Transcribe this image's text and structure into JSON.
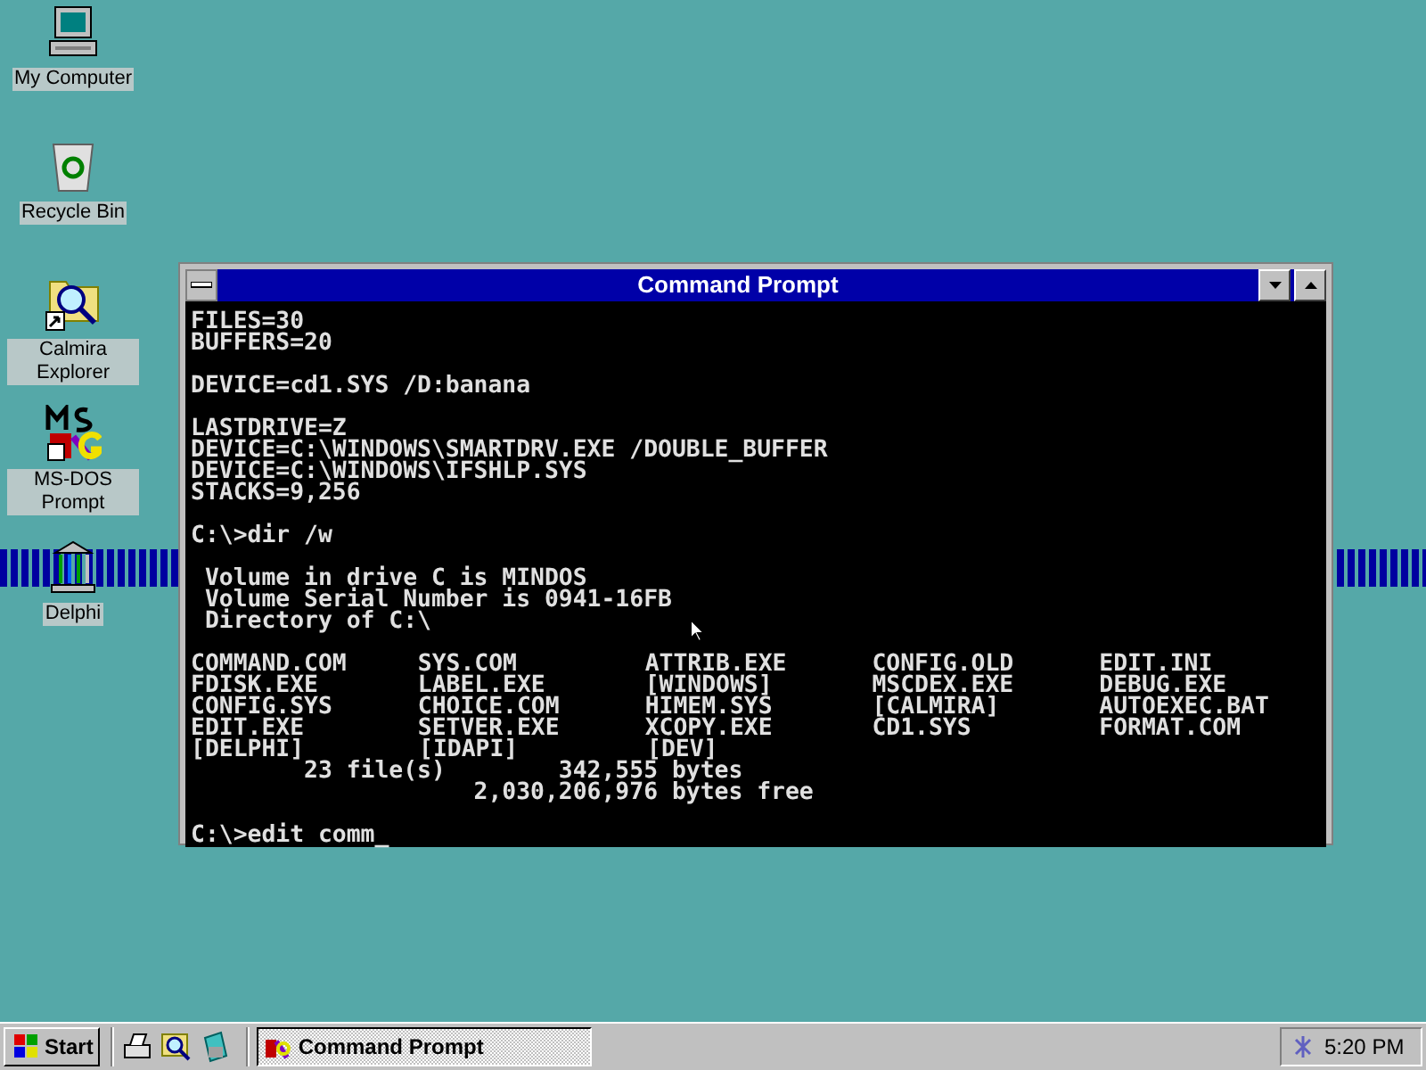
{
  "desktop_icons": [
    {
      "label": "My Computer",
      "kind": "computer"
    },
    {
      "label": "Recycle Bin",
      "kind": "bin"
    },
    {
      "label": "Calmira Explorer",
      "kind": "explorer"
    },
    {
      "label": "MS-DOS Prompt",
      "kind": "msdos"
    },
    {
      "label": "Delphi",
      "kind": "delphi"
    }
  ],
  "window": {
    "title": "Command Prompt",
    "console": [
      {
        "kind": "line",
        "text": "FILES=30"
      },
      {
        "kind": "line",
        "text": "BUFFERS=20"
      },
      {
        "kind": "blank"
      },
      {
        "kind": "line",
        "text": "DEVICE=cd1.SYS /D:banana"
      },
      {
        "kind": "blank"
      },
      {
        "kind": "line",
        "text": "LASTDRIVE=Z"
      },
      {
        "kind": "line",
        "text": "DEVICE=C:\\WINDOWS\\SMARTDRV.EXE /DOUBLE_BUFFER"
      },
      {
        "kind": "line",
        "text": "DEVICE=C:\\WINDOWS\\IFSHLP.SYS"
      },
      {
        "kind": "line",
        "text": "STACKS=9,256"
      },
      {
        "kind": "blank"
      },
      {
        "kind": "line",
        "text": "C:\\>dir /w"
      },
      {
        "kind": "blank"
      },
      {
        "kind": "line",
        "text": " Volume in drive C is MINDOS"
      },
      {
        "kind": "line",
        "text": " Volume Serial Number is 0941-16FB"
      },
      {
        "kind": "line",
        "text": " Directory of C:\\"
      },
      {
        "kind": "blank"
      },
      {
        "kind": "files",
        "rows": [
          [
            "COMMAND.COM",
            "SYS.COM",
            "ATTRIB.EXE",
            "CONFIG.OLD",
            "EDIT.INI"
          ],
          [
            "FDISK.EXE",
            "LABEL.EXE",
            "[WINDOWS]",
            "MSCDEX.EXE",
            "DEBUG.EXE"
          ],
          [
            "CONFIG.SYS",
            "CHOICE.COM",
            "HIMEM.SYS",
            "[CALMIRA]",
            "AUTOEXEC.BAT"
          ],
          [
            "EDIT.EXE",
            "SETVER.EXE",
            "XCOPY.EXE",
            "CD1.SYS",
            "FORMAT.COM"
          ],
          [
            "[DELPHI]",
            "[IDAPI]",
            "[DEV]"
          ]
        ]
      },
      {
        "kind": "line",
        "text": "        23 file(s)        342,555 bytes"
      },
      {
        "kind": "line",
        "text": "                    2,030,206,976 bytes free"
      },
      {
        "kind": "blank"
      },
      {
        "kind": "line",
        "text": "C:\\>edit comm_"
      }
    ]
  },
  "taskbar": {
    "start": "Start",
    "tasks": [
      {
        "label": "Command Prompt",
        "selected": true
      }
    ],
    "clock": "5:20 PM"
  }
}
